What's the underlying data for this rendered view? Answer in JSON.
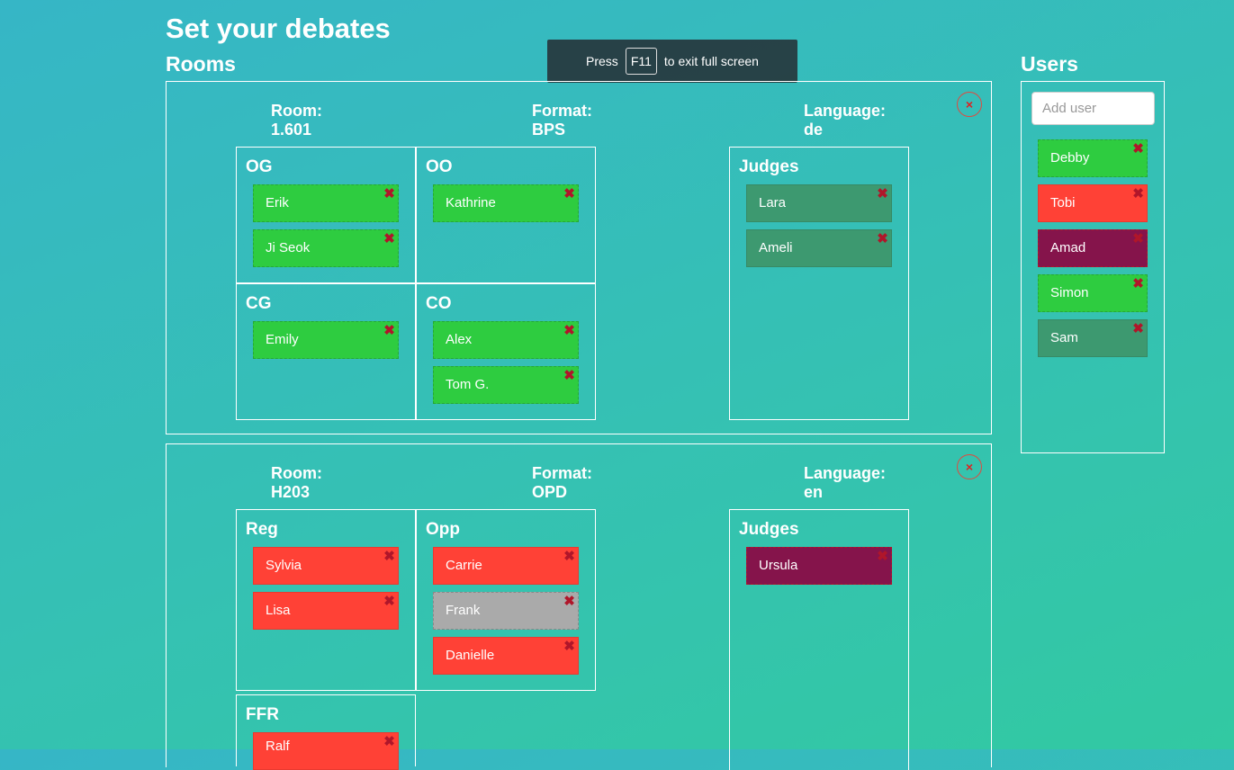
{
  "page": {
    "title": "Set your debates"
  },
  "rooms_title": "Rooms",
  "users_title": "Users",
  "fullscreen_toast": {
    "press": "Press",
    "key": "F11",
    "suffix": "to exit full screen"
  },
  "close_glyph": "×",
  "remove_glyph": "✖",
  "rooms": [
    {
      "room_label": "Room:",
      "room": "1.601",
      "format_label": "Format:",
      "format": "BPS",
      "language_label": "Language:",
      "language": "de",
      "teams": [
        {
          "name": "OG",
          "members": [
            "Erik",
            "Ji Seok"
          ]
        },
        {
          "name": "OO",
          "members": [
            "Kathrine"
          ]
        },
        {
          "name": "CG",
          "members": [
            "Emily"
          ]
        },
        {
          "name": "CO",
          "members": [
            "Alex",
            "Tom G."
          ]
        }
      ],
      "judges": {
        "name": "Judges",
        "members": [
          "Lara",
          "Ameli"
        ]
      }
    },
    {
      "room_label": "Room:",
      "room": "H203",
      "format_label": "Format:",
      "format": "OPD",
      "language_label": "Language:",
      "language": "en",
      "teams": [
        {
          "name": "Reg",
          "members": [
            "Sylvia",
            "Lisa"
          ]
        },
        {
          "name": "Opp",
          "members": [
            "Carrie",
            "Frank",
            "Danielle"
          ]
        },
        {
          "name": "FFR",
          "members": [
            "Ralf"
          ]
        }
      ],
      "judges": {
        "name": "Judges",
        "members": [
          "Ursula"
        ]
      }
    }
  ],
  "users": {
    "placeholder": "Add user",
    "list": [
      "Debby",
      "Tobi",
      "Amad",
      "Simon",
      "Sam"
    ]
  },
  "colors": {
    "green": "#2ecc40",
    "red": "#ff4136",
    "grey": "#aaaaaa",
    "teal": "#3d9970",
    "maroon": "#85144b"
  }
}
